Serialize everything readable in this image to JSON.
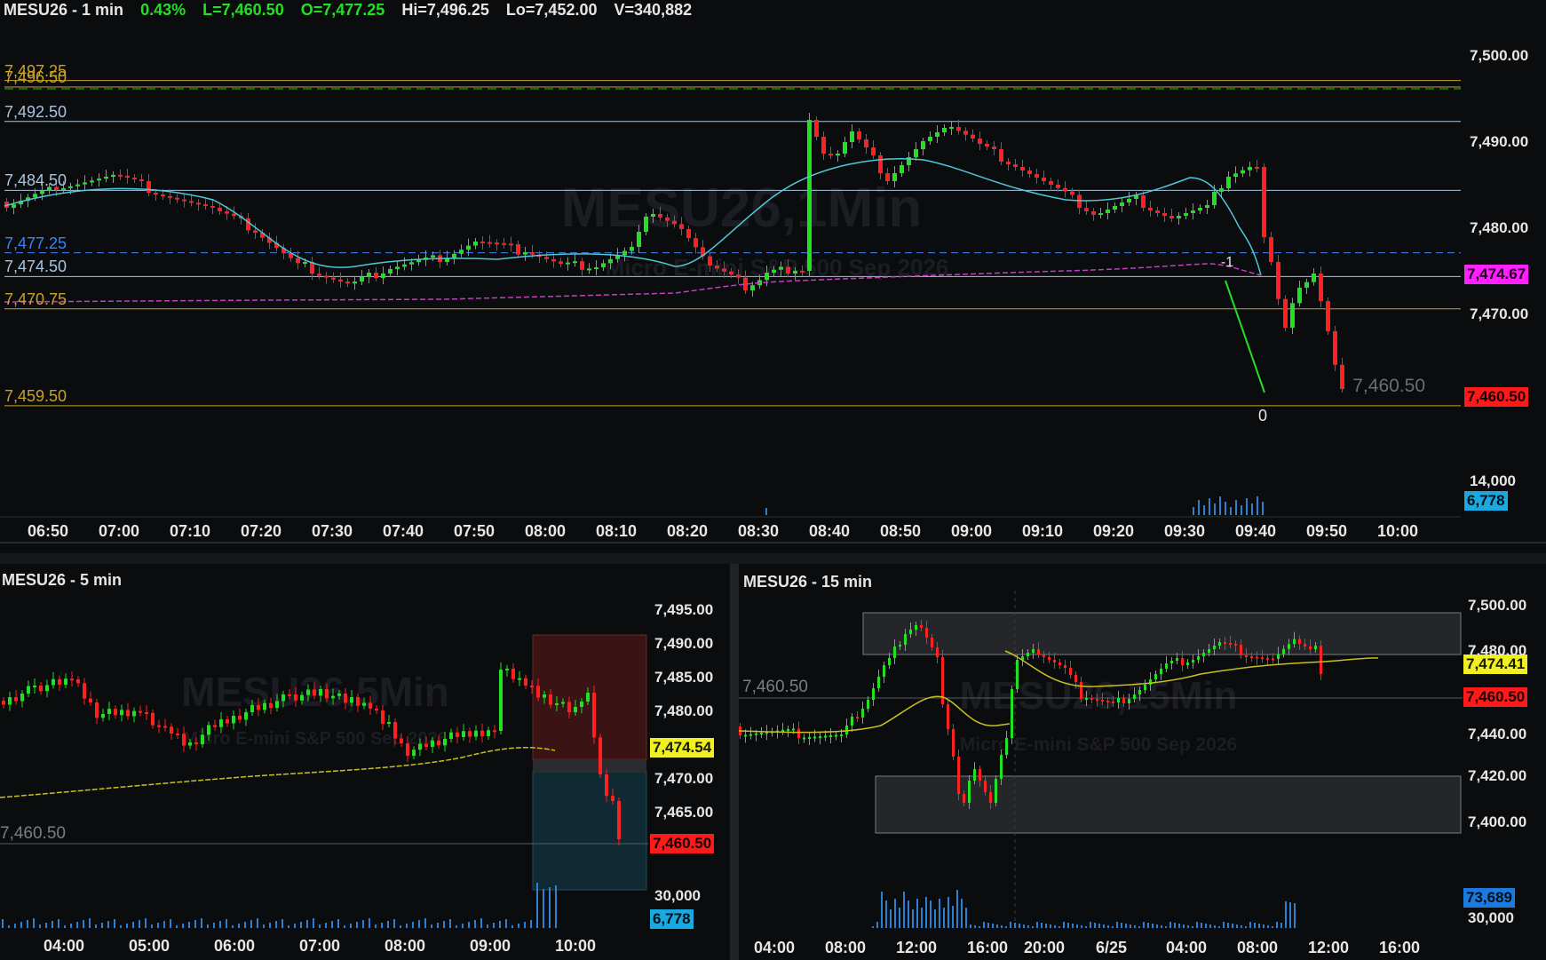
{
  "top": {
    "symbol_title": "MESU26 - 1 min",
    "change_pct": "0.43%",
    "last": "L=7,460.50",
    "open": "O=7,477.25",
    "high": "Hi=7,496.25",
    "low": "Lo=7,452.00",
    "volume": "V=340,882",
    "watermark": "MESU26,1Min",
    "watermark_sub": "Micro E-mini S&P 500 Sep 2026",
    "price_ticks": [
      "7,500.00",
      "7,490.00",
      "7,480.00",
      "7,470.00"
    ],
    "volume_tick": "14,000",
    "time_ticks": [
      "06:50",
      "07:00",
      "07:10",
      "07:20",
      "07:30",
      "07:40",
      "07:50",
      "08:00",
      "08:10",
      "08:20",
      "08:30",
      "08:40",
      "08:50",
      "09:00",
      "09:10",
      "09:20",
      "09:30",
      "09:40",
      "09:50",
      "10:00"
    ],
    "levels": [
      {
        "label": "7,497.25",
        "value": 7497.25,
        "color": "#c9a227"
      },
      {
        "label": "7,496.50",
        "value": 7496.5,
        "color": "#c9a227"
      },
      {
        "label": "7,492.50",
        "value": 7492.5,
        "color": "#a9c4e0"
      },
      {
        "label": "7,484.50",
        "value": 7484.5,
        "color": "#a9c4e0"
      },
      {
        "label": "7,477.25",
        "value": 7477.25,
        "color": "#3b82f6"
      },
      {
        "label": "7,474.50",
        "value": 7474.5,
        "color": "#a9c4e0"
      },
      {
        "label": "7,470.75",
        "value": 7470.75,
        "color": "#c9a227"
      },
      {
        "label": "7,459.50",
        "value": 7459.5,
        "color": "#c9a227"
      }
    ],
    "last_price_ghost": "7,460.50",
    "tag_ema": "7,474.67",
    "tag_last": "7,460.50",
    "tag_volume": "6,778",
    "position_label": "-1",
    "position_label_zero": "0",
    "colors": {
      "up": "#22e022",
      "down": "#ff2020",
      "ema": "#4fc8d8",
      "vwap": "#c040c0"
    }
  },
  "bottom_left": {
    "symbol_title": "MESU26 - 5 min",
    "watermark": "MESU26,5Min",
    "watermark_sub": "Micro E-mini S&P 500 Sep 2026",
    "price_ticks": [
      "7,495.00",
      "7,490.00",
      "7,485.00",
      "7,480.00",
      "7,470.00",
      "7,465.00"
    ],
    "volume_tick": "30,000",
    "time_ticks": [
      "04:00",
      "05:00",
      "06:00",
      "07:00",
      "08:00",
      "09:00",
      "10:00"
    ],
    "level_label": "7,460.50",
    "tag_ma": "7,474.54",
    "tag_last": "7,460.50",
    "tag_volume": "6,778"
  },
  "bottom_right": {
    "symbol_title": "MESU26 - 15 min",
    "watermark": "MESU26,15Min",
    "watermark_sub": "Micro E-mini S&P 500 Sep 2026",
    "price_ticks": [
      "7,500.00",
      "7,480.00",
      "7,440.00",
      "7,420.00",
      "7,400.00"
    ],
    "volume_tick": "30,000",
    "time_ticks": [
      "04:00",
      "08:00",
      "12:00",
      "16:00",
      "20:00",
      "6/25",
      "04:00",
      "08:00",
      "12:00",
      "16:00"
    ],
    "level_label": "7,460.50",
    "tag_ma": "7,474.41",
    "tag_last": "7,460.50",
    "tag_volume": "73,689"
  }
}
